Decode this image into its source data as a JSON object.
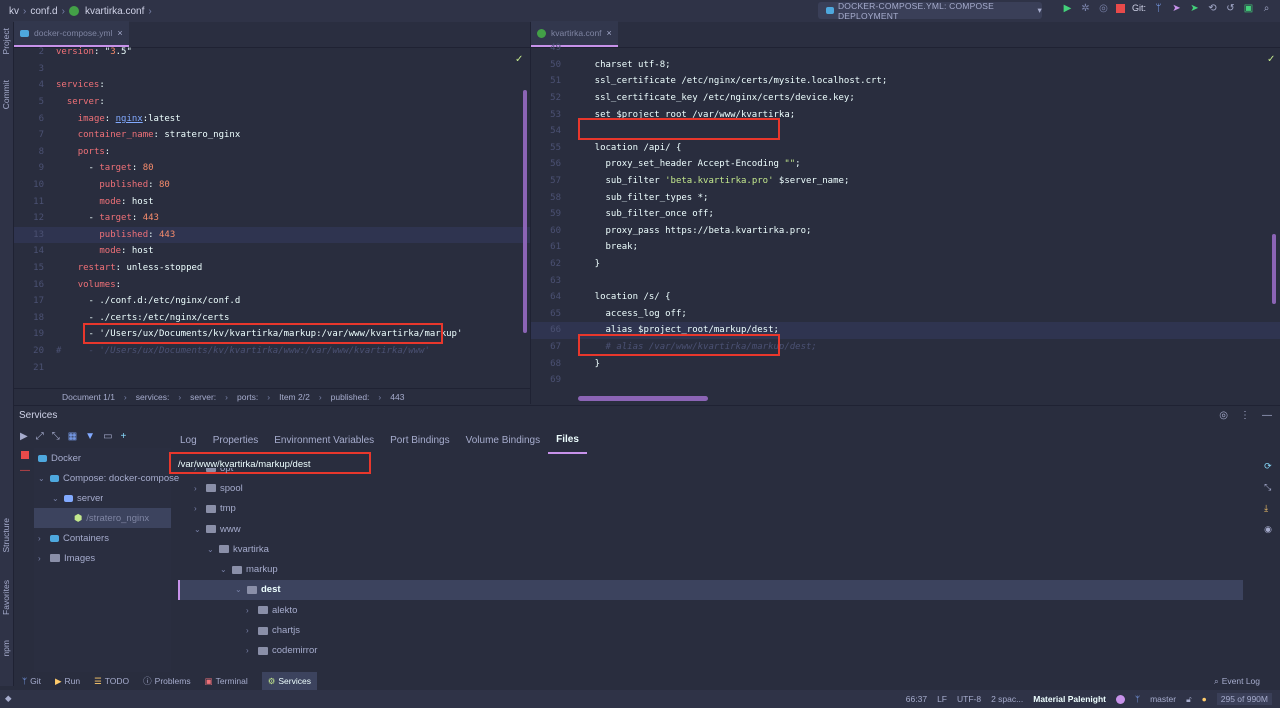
{
  "titlebar": {
    "breadcrumb": [
      "kv",
      "conf.d",
      "kvartirka.conf"
    ],
    "run_config": "DOCKER-COMPOSE.YML: COMPOSE DEPLOYMENT",
    "git_label": "Git:"
  },
  "left_strip": {
    "project": "Project",
    "commit": "Commit",
    "structure": "Structure",
    "favorites": "Favorites",
    "npm": "npm"
  },
  "editor_left": {
    "tab": "docker-compose.yml",
    "lines": [
      {
        "n": "2",
        "text": "version: \"3.5\""
      },
      {
        "n": "3",
        "text": ""
      },
      {
        "n": "4",
        "text": "services:"
      },
      {
        "n": "5",
        "text": "  server:"
      },
      {
        "n": "6",
        "text": "    image: nginx:latest"
      },
      {
        "n": "7",
        "text": "    container_name: stratero_nginx"
      },
      {
        "n": "8",
        "text": "    ports:"
      },
      {
        "n": "9",
        "text": "      - target: 80"
      },
      {
        "n": "10",
        "text": "        published: 80"
      },
      {
        "n": "11",
        "text": "        mode: host"
      },
      {
        "n": "12",
        "text": "      - target: 443"
      },
      {
        "n": "13",
        "text": "        published: 443"
      },
      {
        "n": "14",
        "text": "        mode: host"
      },
      {
        "n": "15",
        "text": "    restart: unless-stopped"
      },
      {
        "n": "16",
        "text": "    volumes:"
      },
      {
        "n": "17",
        "text": "      - ./conf.d:/etc/nginx/conf.d"
      },
      {
        "n": "18",
        "text": "      - ./certs:/etc/nginx/certs"
      },
      {
        "n": "19",
        "text": "      - '/Users/ux/Documents/kv/kvartirka/markup:/var/www/kvartirka/markup'"
      },
      {
        "n": "20",
        "text": "#     - '/Users/ux/Documents/kv/kvartirka/www:/var/www/kvartirka/www'"
      },
      {
        "n": "21",
        "text": ""
      }
    ],
    "breadcrumb": [
      "Document 1/1",
      "services:",
      "server:",
      "ports:",
      "Item 2/2",
      "published:",
      "443"
    ]
  },
  "editor_right": {
    "tab": "kvartirka.conf",
    "lines": [
      {
        "n": "49",
        "text": ""
      },
      {
        "n": "50",
        "text": "    charset utf-8;"
      },
      {
        "n": "51",
        "text": "    ssl_certificate /etc/nginx/certs/mysite.localhost.crt;"
      },
      {
        "n": "52",
        "text": "    ssl_certificate_key /etc/nginx/certs/device.key;"
      },
      {
        "n": "53",
        "text": "    set $project_root /var/www/kvartirka;"
      },
      {
        "n": "54",
        "text": ""
      },
      {
        "n": "55",
        "text": "    location /api/ {"
      },
      {
        "n": "56",
        "text": "      proxy_set_header Accept-Encoding \"\";"
      },
      {
        "n": "57",
        "text": "      sub_filter 'beta.kvartirka.pro' $server_name;"
      },
      {
        "n": "58",
        "text": "      sub_filter_types *;"
      },
      {
        "n": "59",
        "text": "      sub_filter_once off;"
      },
      {
        "n": "60",
        "text": "      proxy_pass https://beta.kvartirka.pro;"
      },
      {
        "n": "61",
        "text": "      break;"
      },
      {
        "n": "62",
        "text": "    }"
      },
      {
        "n": "63",
        "text": ""
      },
      {
        "n": "64",
        "text": "    location /s/ {"
      },
      {
        "n": "65",
        "text": "      access_log off;"
      },
      {
        "n": "66",
        "text": "      alias $project_root/markup/dest;"
      },
      {
        "n": "67",
        "text": "      # alias /var/www/kvartirka/markup/dest;"
      },
      {
        "n": "68",
        "text": "    }"
      },
      {
        "n": "69",
        "text": ""
      }
    ]
  },
  "services": {
    "title": "Services",
    "tree": [
      "Docker",
      "Compose: docker-compose",
      "server",
      "/stratero_nginx",
      "Containers",
      "Images"
    ],
    "tabs": [
      "Log",
      "Properties",
      "Environment Variables",
      "Port Bindings",
      "Volume Bindings",
      "Files"
    ],
    "path": "/var/www/kvartirka/markup/dest",
    "files": [
      "opt",
      "spool",
      "tmp",
      "www",
      "kvartirka",
      "markup",
      "dest",
      "alekto",
      "chartjs",
      "codemirror"
    ]
  },
  "bottom_tools": [
    "Git",
    "Run",
    "TODO",
    "Problems",
    "Terminal",
    "Services"
  ],
  "event_log": "Event Log",
  "status": {
    "position": "66:37",
    "line_sep": "LF",
    "encoding": "UTF-8",
    "indent": "2 spac...",
    "theme": "Material Palenight",
    "branch": "master",
    "memory": "295 of 990M"
  },
  "colors": {
    "accent": "#c792ea",
    "highlight_box": "#e8372c",
    "background": "#292d3e"
  }
}
